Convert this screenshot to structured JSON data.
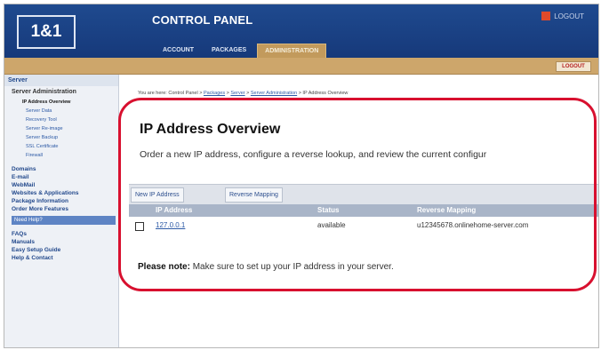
{
  "brand": {
    "logo": "1&1",
    "title": "CONTROL PANEL",
    "logout": "LOGOUT"
  },
  "tabs": [
    {
      "label": "ACCOUNT"
    },
    {
      "label": "PACKAGES"
    },
    {
      "label": "ADMINISTRATION"
    }
  ],
  "tanbar": {
    "logout_button": "LOGOUT"
  },
  "sidebar": {
    "section": "Server",
    "subsection": "Server Administration",
    "items": [
      {
        "label": "IP Address Overview"
      },
      {
        "label": "Server Data"
      },
      {
        "label": "Recovery Tool"
      },
      {
        "label": "Server Re-image"
      },
      {
        "label": "Server Backup"
      },
      {
        "label": "SSL Certificate"
      },
      {
        "label": "Firewall"
      }
    ],
    "main_items": [
      {
        "label": "Domains"
      },
      {
        "label": "E-mail"
      },
      {
        "label": "WebMail"
      },
      {
        "label": "Websites & Applications"
      },
      {
        "label": "Package Information"
      },
      {
        "label": "Order More Features"
      }
    ],
    "help_title": "Need Help?",
    "help_items": [
      {
        "label": "FAQs"
      },
      {
        "label": "Manuals"
      },
      {
        "label": "Easy Setup Guide"
      },
      {
        "label": "Help & Contact"
      }
    ]
  },
  "breadcrumb": {
    "prefix": "You are here: Control Panel >",
    "links": [
      "Packages",
      "Server",
      "Server Administration"
    ],
    "current": "> IP Address Overview"
  },
  "main": {
    "title": "IP Address Overview",
    "description": "Order a new IP address, configure a reverse lookup, and review the current configur",
    "buttons": {
      "new_ip": "New IP Address",
      "reverse": "Reverse Mapping"
    },
    "columns": [
      "IP Address",
      "Status",
      "Reverse Mapping"
    ],
    "rows": [
      {
        "ip": "127.0.0.1",
        "status": "available",
        "reverse": "u12345678.onlinehome-server.com"
      }
    ],
    "note_label": "Please note:",
    "note_text": "Make sure to set up your IP address in your server."
  },
  "colors": {
    "header": "#1f4a8f",
    "tan": "#cda66b",
    "highlight": "#d8102f",
    "link": "#2d5aa6"
  }
}
